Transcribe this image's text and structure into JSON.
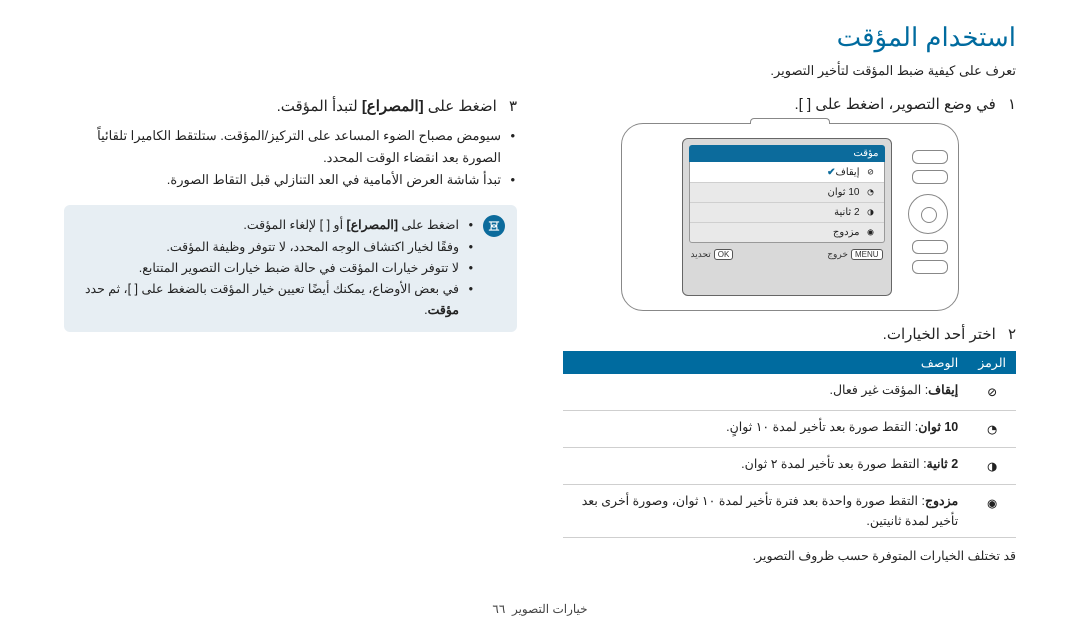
{
  "title": "استخدام المؤقت",
  "intro": "تعرف على كيفية ضبط المؤقت لتأخير التصوير.",
  "steps": {
    "n1": "١",
    "s1": "في وضع التصوير، اضغط على [   ].",
    "n2": "٢",
    "s2": "اختر أحد الخيارات.",
    "n3": "٣",
    "s3_pre": "اضغط على ",
    "s3_btn": "[المصراع]",
    "s3_post": " لتبدأ المؤقت."
  },
  "camera": {
    "menu_title": "مؤقت",
    "row1": "إيقاف",
    "row2": "10 ثوان",
    "row3": "2 ثانية",
    "row4": "مزدوج",
    "footer_menu_badge": "MENU",
    "footer_menu_label": "خروج",
    "footer_ok_badge": "OK",
    "footer_ok_label": "تحديد"
  },
  "table": {
    "h_icon": "الرمز",
    "h_desc": "الوصف",
    "rows": [
      {
        "b": "إيقاف",
        "t": ": المؤقت غير فعال."
      },
      {
        "b": "10 ثوان",
        "t": ": التقط صورة بعد تأخير لمدة ١٠ ثوانٍ."
      },
      {
        "b": "2 ثانية",
        "t": ": التقط صورة بعد تأخير لمدة ٢ ثوان."
      },
      {
        "b": "مزدوج",
        "t": ": التقط صورة واحدة بعد فترة تأخير لمدة ١٠ ثوان، وصورة أخرى بعد تأخير لمدة ثانيتين."
      }
    ],
    "note": "قد تختلف الخيارات المتوفرة حسب ظروف التصوير."
  },
  "step3_bullets": [
    "سيومض مصباح الضوء المساعد على التركيز/المؤقت. ستلتقط الكاميرا تلقائياً الصورة بعد انقضاء الوقت المحدد.",
    "تبدأ شاشة العرض الأمامية في العد التنازلي قبل التقاط الصورة."
  ],
  "note_box": {
    "b1_pre": "اضغط على ",
    "b1_btn": "[المصراع]",
    "b1_post": " أو [   ] لإلغاء المؤقت.",
    "b2": "وفقًا لخيار اكتشاف الوجه المحدد، لا تتوفر وظيفة المؤقت.",
    "b3": "لا تتوفر خيارات المؤقت في حالة ضبط خيارات التصوير المتتابع.",
    "b4_pre": "في بعض الأوضاع، يمكنك أيضًا تعيين خيار المؤقت بالضغط على [   ]، ثم حدد ",
    "b4_bold": "مؤقت",
    "b4_post": "."
  },
  "footer": {
    "section": "خيارات التصوير",
    "page": "٦٦"
  }
}
